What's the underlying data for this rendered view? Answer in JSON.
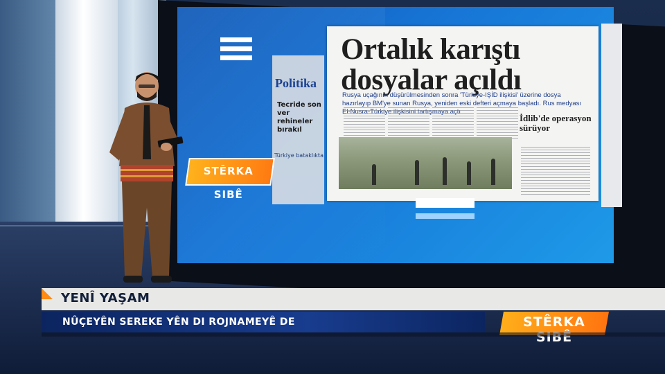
{
  "screen": {
    "headline_line1": "Ortalık karıştı",
    "headline_line2": "dosyalar açıldı",
    "subheadline": "Rusya uçağının düşürülmesinden sonra 'Türkiye-IŞİD ilişkisi' üzerine dosya hazırlayıp BM'ye sunan Rusya, yeniden eski defteri açmaya başladı. Rus medyası El-Nusra-Türkiye ilişkisini tartışmaya açtı",
    "side_headline": "İdlib'de operasyon sürüyor",
    "background_paper_name": "Politika",
    "background_headline": "Tecride son ver rehineler bırakıl",
    "background_caption": "Türkiye bataklıkta",
    "screen_logo": "STÊRKA SIBÊ"
  },
  "lower_third": {
    "title": "YENÎ YAŞAM",
    "subtitle": "NÛÇEYÊN SEREKE YÊN DI ROJNAMEYÊ DE",
    "channel_logo": "STÊRKA SIBÊ"
  },
  "colors": {
    "accent_orange": "#ff8a14",
    "screen_blue": "#1775d6",
    "lower_third_blue": "#183c8e"
  }
}
